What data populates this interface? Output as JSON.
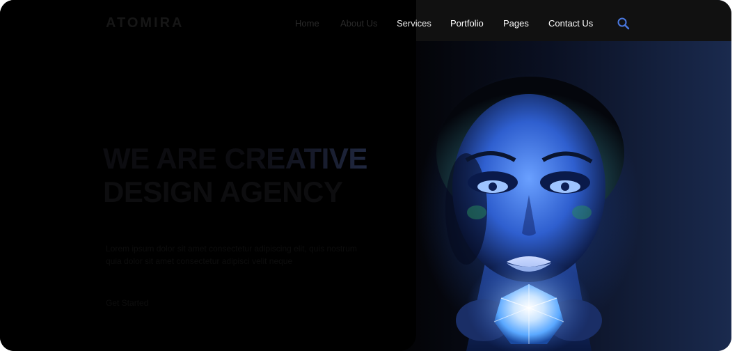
{
  "brand": {
    "logo_text": "ATOMIRA"
  },
  "nav": {
    "items": [
      {
        "label": "Home"
      },
      {
        "label": "About Us"
      },
      {
        "label": "Services"
      },
      {
        "label": "Portfolio"
      },
      {
        "label": "Pages"
      },
      {
        "label": "Contact Us"
      }
    ],
    "search_icon": "search-icon"
  },
  "hero": {
    "headline_line1": "WE ARE CREATIVE",
    "headline_line2": "DESIGN AGENCY",
    "description": "Lorem ipsum dolor sit amet consectetur adipiscing elit, quis nostrum quia dolor sit amet consectetur adipisci velit neque",
    "cta_label": "Get Started"
  },
  "colors": {
    "nav_bg": "#111111",
    "accent_blue": "#4a78e0",
    "overlay": "#000000"
  }
}
